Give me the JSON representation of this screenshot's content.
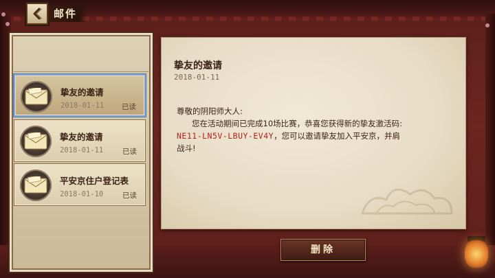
{
  "header": {
    "title": "邮件"
  },
  "mail_list": [
    {
      "title": "挚友的邀请",
      "date": "2018-01-11",
      "status": "已读",
      "selected": true
    },
    {
      "title": "挚友的邀请",
      "date": "2018-01-11",
      "status": "已读",
      "selected": false
    },
    {
      "title": "平安京住户登记表",
      "date": "2018-01-10",
      "status": "已读",
      "selected": false
    }
  ],
  "mail_detail": {
    "title": "挚友的邀请",
    "date": "2018-01-11",
    "greeting": "尊敬的阴阳师大人:",
    "line1": "您在活动期间已完成10场比赛，恭喜您获得新的挚友激活码:",
    "code": "NE11-LN5V-LBUY-EV4Y",
    "line2_after_code": "，您可以邀请挚友加入平安京，并肩",
    "line3": "战斗!"
  },
  "actions": {
    "delete_label": "删除"
  },
  "colors": {
    "code_red": "#b02121",
    "selected_border": "#7fa7d8"
  },
  "icons": {
    "back": "back-arrow-icon",
    "mail": "envelope-icon",
    "lantern": "lantern-icon"
  }
}
